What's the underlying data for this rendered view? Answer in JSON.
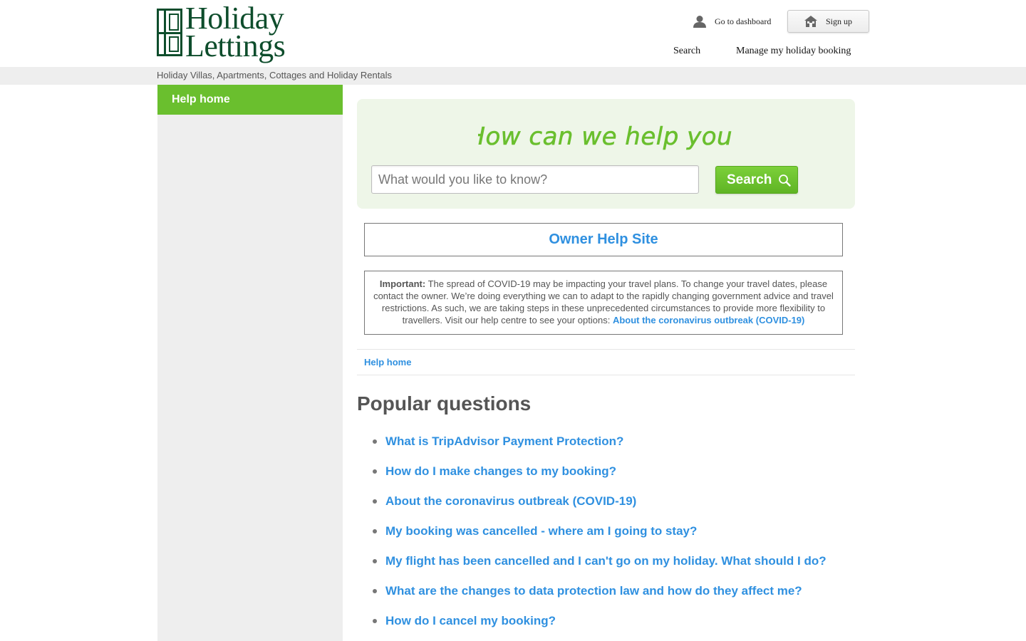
{
  "brand": {
    "logo_line1": "Holiday",
    "logo_line2": "Lettings",
    "logo_color": "#0e4d2c",
    "tagline": "Holiday Villas, Apartments, Cottages and Holiday Rentals"
  },
  "header": {
    "dashboard_label": "Go to dashboard",
    "dashboard_icon": "person-icon",
    "signup_label": "Sign up",
    "signup_icon": "house-icon",
    "nav": [
      {
        "label": "Search"
      },
      {
        "label": "Manage my holiday booking"
      }
    ]
  },
  "sidebar": {
    "items": [
      {
        "label": "Help home",
        "active": true
      }
    ],
    "active_color": "#6abf2e"
  },
  "search": {
    "heading": "How can we help you?",
    "placeholder": "What would you like to know?",
    "value": "",
    "button_label": "Search",
    "button_icon": "magnifier-icon",
    "accent_color": "#6abf2e"
  },
  "owner_help": {
    "label": "Owner Help Site"
  },
  "notice": {
    "strong": "Important:",
    "text": " The spread of COVID-19 may be impacting your travel plans. To change your travel dates, please contact the owner. We’re doing everything we can to adapt to the rapidly changing government advice and travel restrictions. As such, we are taking steps in these unprecedented circumstances to provide more flexibility to travellers. Visit our help centre to see your options: ",
    "link": "About the coronavirus outbreak (COVID-19)"
  },
  "breadcrumb": {
    "items": [
      "Help home"
    ]
  },
  "popular": {
    "title": "Popular questions",
    "questions": [
      "What is TripAdvisor Payment Protection?",
      "How do I make changes to my booking?",
      "About the coronavirus outbreak (COVID-19)",
      "My booking was cancelled - where am I going to stay?",
      "My flight has been cancelled and I can't go on my holiday. What should I do?",
      "What are the changes to data protection law and how do they affect me?",
      "How do I cancel my booking?"
    ]
  },
  "colors": {
    "link": "#2f90e0",
    "panel_bg": "#eef6e8",
    "sidebar_bg": "#eeeeee"
  }
}
